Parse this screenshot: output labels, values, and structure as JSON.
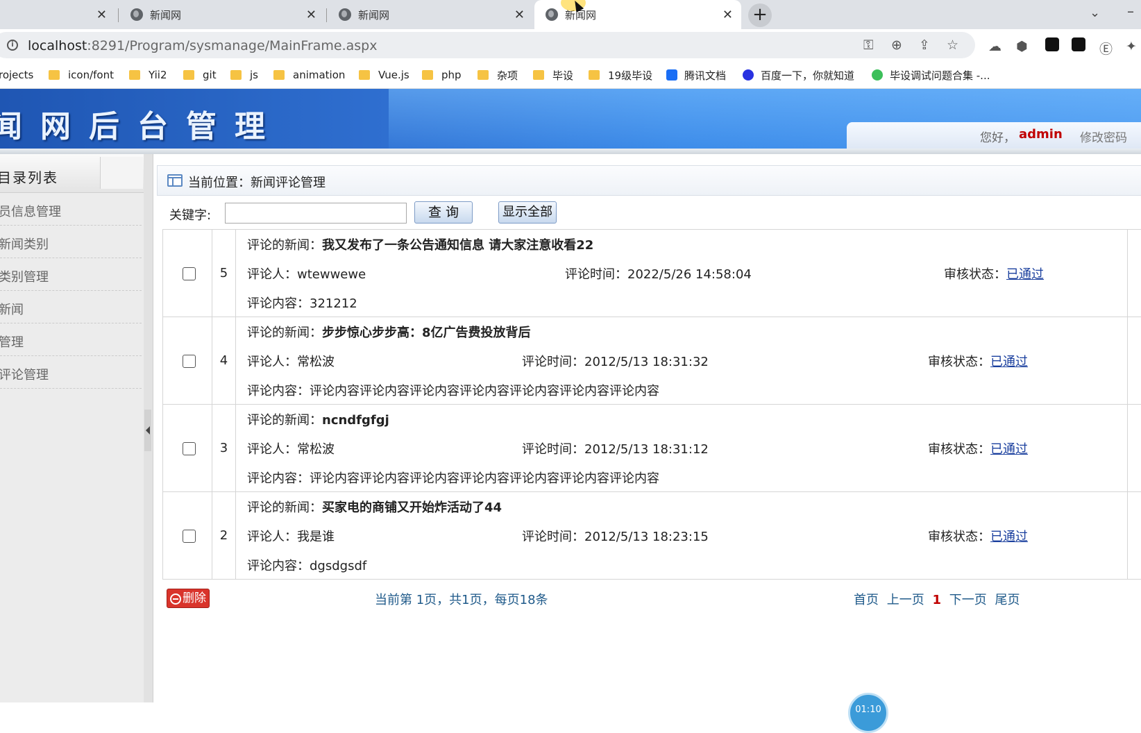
{
  "browser": {
    "tabs": [
      {
        "title": "",
        "active": false
      },
      {
        "title": "新闻网",
        "active": false
      },
      {
        "title": "新闻网",
        "active": false
      },
      {
        "title": "新闻网",
        "active": true
      }
    ],
    "url_host": "localhost",
    "url_rest": ":8291/Program/sysmanage/MainFrame.aspx",
    "bookmarks": [
      "rojects",
      "icon/font",
      "Yii2",
      "git",
      "js",
      "animation",
      "Vue.js",
      "php",
      "杂项",
      "毕设",
      "19级毕设",
      "腾讯文档",
      "百度一下，你就知道",
      "毕设调试问题合集 -..."
    ]
  },
  "header": {
    "title": "闻网后台管理",
    "greeting": "您好，",
    "username": "admin",
    "change_password": "修改密码"
  },
  "sidebar": {
    "title": "目录列表",
    "items": [
      "员信息管理",
      "新闻类别",
      "类别管理",
      "新闻",
      "管理",
      "评论管理"
    ]
  },
  "main": {
    "location": "当前位置：新闻评论管理",
    "search": {
      "label": "关键字:",
      "value": "",
      "query_button": "查 询",
      "show_all_button": "显示全部"
    },
    "labels": {
      "news": "评论的新闻：",
      "commenter": "评论人：",
      "time": "评论时间：",
      "status": "审核状态：",
      "content": "评论内容："
    },
    "comments": [
      {
        "id": "5",
        "news": "我又发布了一条公告通知信息 请大家注意收看22",
        "commenter": "wtewwewe",
        "time": "2022/5/26 14:58:04",
        "status": "已通过",
        "content": "321212"
      },
      {
        "id": "4",
        "news": "步步惊心步步高：8亿广告费投放背后",
        "commenter": "常松波",
        "time": "2012/5/13 18:31:32",
        "status": "已通过",
        "content": "评论内容评论内容评论内容评论内容评论内容评论内容评论内容"
      },
      {
        "id": "3",
        "news": "ncndfgfgj",
        "commenter": "常松波",
        "time": "2012/5/13 18:31:12",
        "status": "已通过",
        "content": "评论内容评论内容评论内容评论内容评论内容评论内容评论内容"
      },
      {
        "id": "2",
        "news": "买家电的商铺又开始炸活动了44",
        "commenter": "我是谁",
        "time": "2012/5/13 18:23:15",
        "status": "已通过",
        "content": "dgsdgsdf"
      }
    ],
    "delete_button": "删除",
    "page_info": "当前第 1页，共1页，每页18条",
    "pager": {
      "first": "首页",
      "prev": "上一页",
      "current": "1",
      "next": "下一页",
      "last": "尾页"
    }
  },
  "recorder_time": "01:10"
}
